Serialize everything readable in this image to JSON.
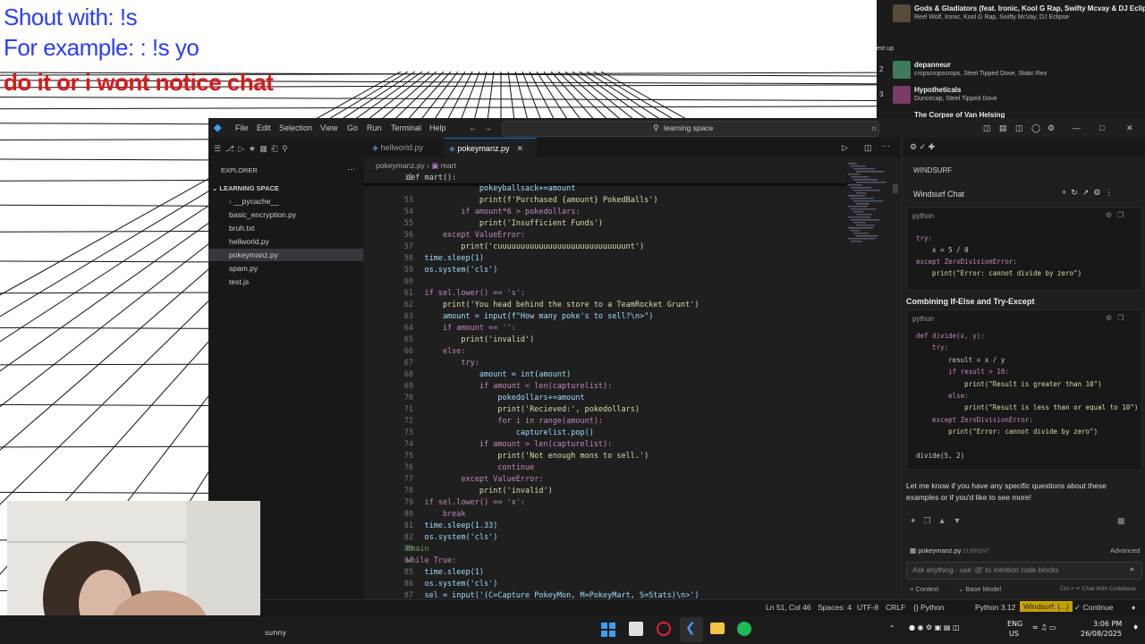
{
  "overlay": {
    "line1": "Shout with: !s",
    "line2": "For example: : !s yo",
    "line3": "do it or i wont notice chat",
    "color_blue": "#2a3dff",
    "color_red": "#d91a1a"
  },
  "music": {
    "now_playing": {
      "title": "Gods & Gladiators (feat. Ironic, Kool G Rap, Swifty Mcvay & DJ Eclipse)",
      "artists": "Reel Wolf, Ironic, Kool G Rap, Swifty McVay, DJ Eclipse"
    },
    "next_label": "ext up",
    "queue": [
      {
        "num": "2",
        "title": "depanneur",
        "artists": "cropscropscrops, Steel Tipped Dove, Static Rex"
      },
      {
        "num": "3",
        "title": "Hypotheticals",
        "artists": "Duncecap, Steel Tipped Dove"
      },
      {
        "num": "",
        "title": "The Corpse of Van Helsing",
        "artists": ""
      }
    ]
  },
  "vscode": {
    "menu": [
      "File",
      "Edit",
      "Selection",
      "View",
      "Go",
      "Run",
      "Terminal",
      "Help"
    ],
    "search_text": "learning space",
    "explorer_label": "EXPLORER",
    "folder": "LEARNING SPACE",
    "files": [
      "__pycache__",
      "basic_encryption.py",
      "bruh.txt",
      "hellworld.py",
      "pokeymanz.py",
      "spam.py",
      "test.js"
    ],
    "tabs": [
      "hellworld.py",
      "pokeymanz.py"
    ],
    "breadcrumb": {
      "file": "pokeymanz.py",
      "symbol": "mart"
    },
    "sticky": {
      "num": "39",
      "text": "def mart():"
    },
    "lines": [
      {
        "n": "",
        "t": "                pokeyballsack+=amount"
      },
      {
        "n": "53",
        "t": "                print(f'Purchased {amount} PokedBalls')"
      },
      {
        "n": "54",
        "t": "            if amount*6 > pokedollars:"
      },
      {
        "n": "55",
        "t": "                print('Insufficient Funds')"
      },
      {
        "n": "56",
        "t": "        except ValueError:"
      },
      {
        "n": "57",
        "t": "            print('cuuuuuuuuuuuuuuuuuuuuuuuuuuuunt')"
      },
      {
        "n": "58",
        "t": "    time.sleep(1)"
      },
      {
        "n": "59",
        "t": "    os.system('cls')"
      },
      {
        "n": "60",
        "t": ""
      },
      {
        "n": "61",
        "t": "    if sel.lower() == 's':"
      },
      {
        "n": "62",
        "t": "        print('You head behind the store to a TeamRocket Grunt')"
      },
      {
        "n": "63",
        "t": "        amount = input(f\"How many poke's to sell?\\n>\")"
      },
      {
        "n": "64",
        "t": "        if amount == '':"
      },
      {
        "n": "65",
        "t": "            print('invalid')"
      },
      {
        "n": "66",
        "t": "        else:"
      },
      {
        "n": "67",
        "t": "            try:"
      },
      {
        "n": "68",
        "t": "                amount = int(amount)"
      },
      {
        "n": "69",
        "t": "                if amount < len(capturelist):"
      },
      {
        "n": "70",
        "t": "                    pokedollars+=amount"
      },
      {
        "n": "71",
        "t": "                    print('Recieved:', pokedollars)"
      },
      {
        "n": "72",
        "t": "                    for i in range(amount):"
      },
      {
        "n": "73",
        "t": "                        capturelist.pop()"
      },
      {
        "n": "74",
        "t": "                if amount > len(capturelist):"
      },
      {
        "n": "75",
        "t": "                    print('Not enough mons to sell.')"
      },
      {
        "n": "76",
        "t": "                    continue"
      },
      {
        "n": "77",
        "t": "            except ValueError:"
      },
      {
        "n": "78",
        "t": "                print('invalid')"
      },
      {
        "n": "79",
        "t": "    if sel.lower() == 'x':"
      },
      {
        "n": "80",
        "t": "        break"
      },
      {
        "n": "81",
        "t": "    time.sleep(1.33)"
      },
      {
        "n": "82",
        "t": "    os.system('cls')"
      },
      {
        "n": "83",
        "t": "#main"
      },
      {
        "n": "84",
        "t": "while True:"
      },
      {
        "n": "85",
        "t": "    time.sleep(1)"
      },
      {
        "n": "86",
        "t": "    os.system('cls')"
      },
      {
        "n": "87",
        "t": "    sel = input('(C=Capture PokeyMon, M=PokeyMart, S=Stats)\\n>')"
      }
    ],
    "chat": {
      "header": "WINDSURF",
      "title": "Windsurf Chat",
      "lang1": "python",
      "block1": [
        "try:",
        "    x = 5 / 0",
        "except ZeroDivisionError:",
        "    print(\"Error: cannot divide by zero\")"
      ],
      "section": "Combining If-Else and Try-Except",
      "lang2": "python",
      "block2": [
        "def divide(x, y):",
        "    try:",
        "        result = x / y",
        "        if result > 10:",
        "            print(\"Result is greater than 10\")",
        "        else:",
        "            print(\"Result is less than or equal to 10\")",
        "    except ZeroDivisionError:",
        "        print(\"Error: cannot divide by zero\")",
        "",
        "divide(5, 2)"
      ],
      "message": "Let me know if you have any specific questions about these examples or if you'd like to see more!",
      "context_file": "pokeymanz.py",
      "context_tag": "CURRENT",
      "advanced": "Advanced",
      "input_placeholder": "Ask anything - use '@' to mention code blocks",
      "footer_context": "Context",
      "footer_model": "Base Model",
      "footer_hint": "Ctrl + ↵  Chat With Codebase"
    },
    "status": {
      "position": "Ln 51, Col 46",
      "spaces": "Spaces: 4",
      "encoding": "UTF-8",
      "eol": "CRLF",
      "lang": "Python",
      "version": "Python 3.12",
      "windsurf": "Windsurf: {...}",
      "continue": "Continue"
    }
  },
  "webcam": {
    "name_tag": "sunny"
  },
  "taskbar": {
    "lang1": "ENG",
    "lang2": "US",
    "time": "3:06 PM",
    "date": "26/08/2025"
  }
}
